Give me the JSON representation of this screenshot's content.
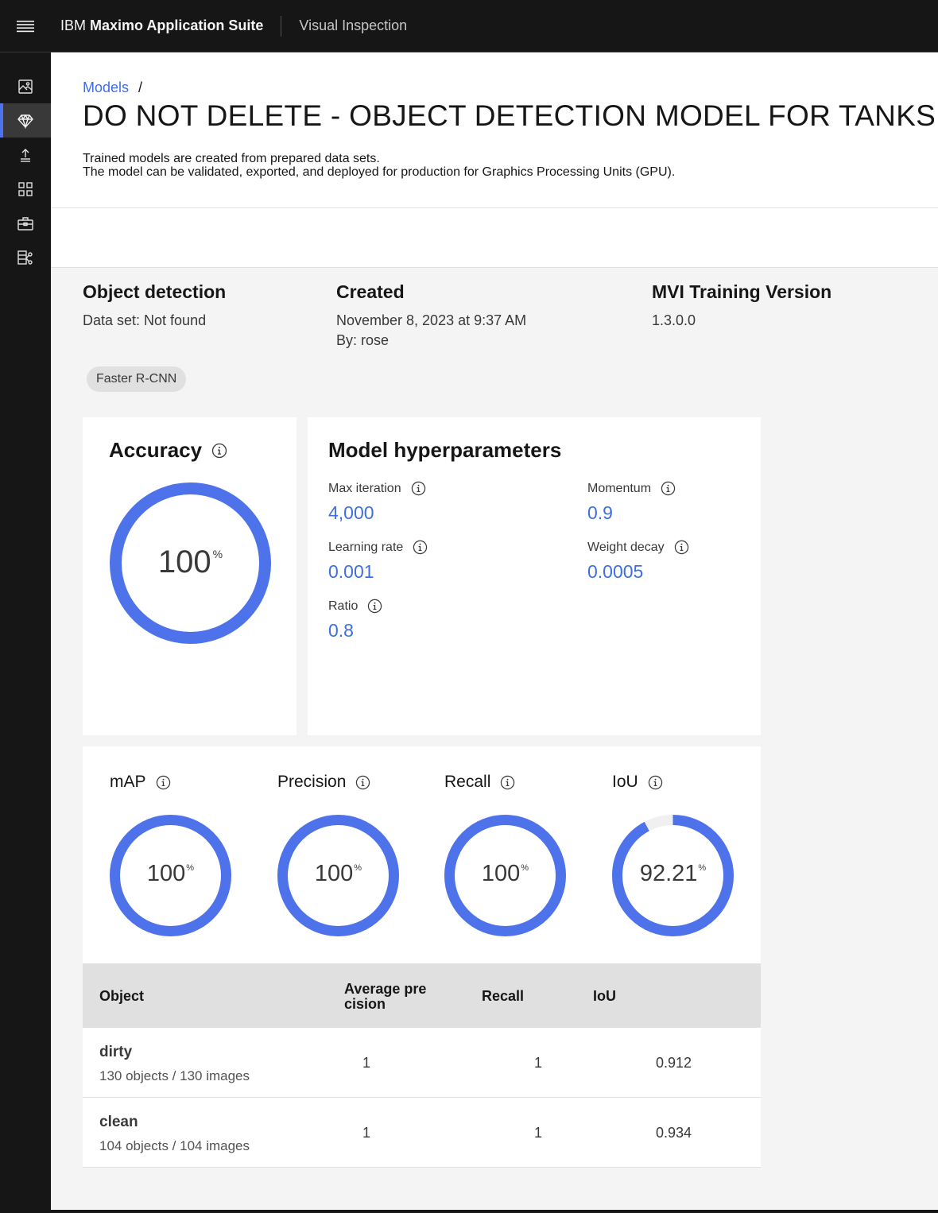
{
  "topbar": {
    "brand_prefix": "IBM",
    "brand_name": "Maximo Application Suite",
    "product": "Visual Inspection"
  },
  "sidenav": {
    "items": [
      {
        "icon": "image-icon",
        "active": false
      },
      {
        "icon": "diamond-icon",
        "active": true
      },
      {
        "icon": "upload-icon",
        "active": false
      },
      {
        "icon": "dashboard-icon",
        "active": false
      },
      {
        "icon": "toolbox-icon",
        "active": false
      },
      {
        "icon": "data-share-icon",
        "active": false
      }
    ]
  },
  "header": {
    "breadcrumb_link": "Models",
    "breadcrumb_sep": "/",
    "title": "DO NOT DELETE - OBJECT DETECTION MODEL FOR TANKS",
    "desc_line1": "Trained models are created from prepared data sets.",
    "desc_line2": "The model can be validated, exported, and deployed for production for Graphics Processing Units (GPU)."
  },
  "summary": {
    "type_title": "Object detection",
    "dataset": "Data set: Not found",
    "created_title": "Created",
    "created_date": "November 8, 2023 at 9:37 AM",
    "created_by": "By: rose",
    "version_title": "MVI Training Version",
    "version": "1.3.0.0",
    "tag": "Faster R-CNN"
  },
  "accuracy": {
    "title": "Accuracy",
    "value": "100",
    "unit": "%",
    "fraction": 1.0
  },
  "hyperparameters": {
    "title": "Model hyperparameters",
    "max_iteration_label": "Max iteration",
    "max_iteration": "4,000",
    "momentum_label": "Momentum",
    "momentum": "0.9",
    "learning_rate_label": "Learning rate",
    "learning_rate": "0.001",
    "weight_decay_label": "Weight decay",
    "weight_decay": "0.0005",
    "ratio_label": "Ratio",
    "ratio": "0.8"
  },
  "metrics": [
    {
      "label": "mAP",
      "value": "100",
      "unit": "%",
      "fraction": 1.0
    },
    {
      "label": "Precision",
      "value": "100",
      "unit": "%",
      "fraction": 1.0
    },
    {
      "label": "Recall",
      "value": "100",
      "unit": "%",
      "fraction": 1.0
    },
    {
      "label": "IoU",
      "value": "92.21",
      "unit": "%",
      "fraction": 0.9221
    }
  ],
  "table": {
    "col_object": "Object",
    "col_ap_line1": "Average pre",
    "col_ap_line2": "cision",
    "col_recall": "Recall",
    "col_iou": "IoU",
    "rows": [
      {
        "name": "dirty",
        "sub": "130 objects / 130 images",
        "ap": "1",
        "recall": "1",
        "iou": "0.912"
      },
      {
        "name": "clean",
        "sub": "104 objects / 104 images",
        "ap": "1",
        "recall": "1",
        "iou": "0.934"
      }
    ]
  },
  "colors": {
    "accent": "#4d72ea",
    "link": "#3e6fe0",
    "track": "#f0f0f0"
  }
}
